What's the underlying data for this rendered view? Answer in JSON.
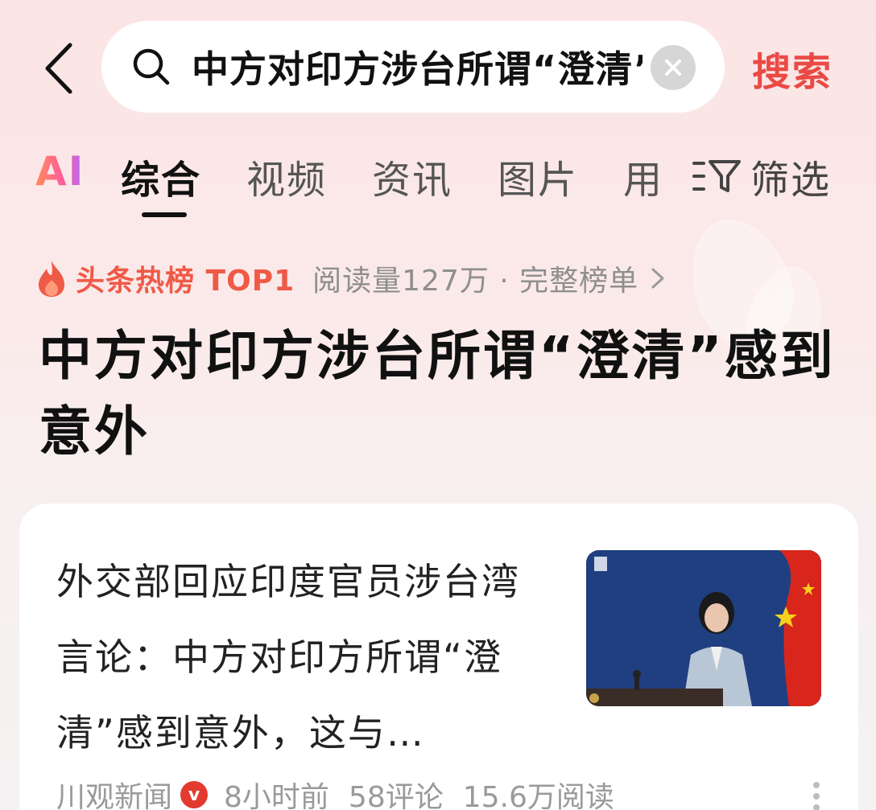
{
  "search": {
    "query": "中方对印方涉台所谓“澄清”感到意外",
    "submit_label": "搜索"
  },
  "tabs": [
    {
      "label": "AI",
      "active": false
    },
    {
      "label": "综合",
      "active": true
    },
    {
      "label": "视频",
      "active": false
    },
    {
      "label": "资讯",
      "active": false
    },
    {
      "label": "图片",
      "active": false
    },
    {
      "label": "用户",
      "active": false
    }
  ],
  "filter": {
    "label": "筛选",
    "icon": "filter-icon"
  },
  "hot": {
    "label": "头条热榜 TOP1",
    "meta": "阅读量127万 · 完整榜单",
    "icon": "flame-icon",
    "color": "#ef5a47"
  },
  "headline": "中方对印方涉台所谓“澄清”感到意外",
  "card": {
    "title": "外交部回应印度官员涉台湾言论：中方对印方所谓“澄清”感到意外，这与…",
    "source": "川观新闻",
    "verified_mark": "v",
    "time": "8小时前",
    "comments": "58评论",
    "reads": "15.6万阅读"
  },
  "colors": {
    "accent": "#ea4a45",
    "background_top": "#fbe4e4",
    "card_bg": "#ffffff"
  }
}
